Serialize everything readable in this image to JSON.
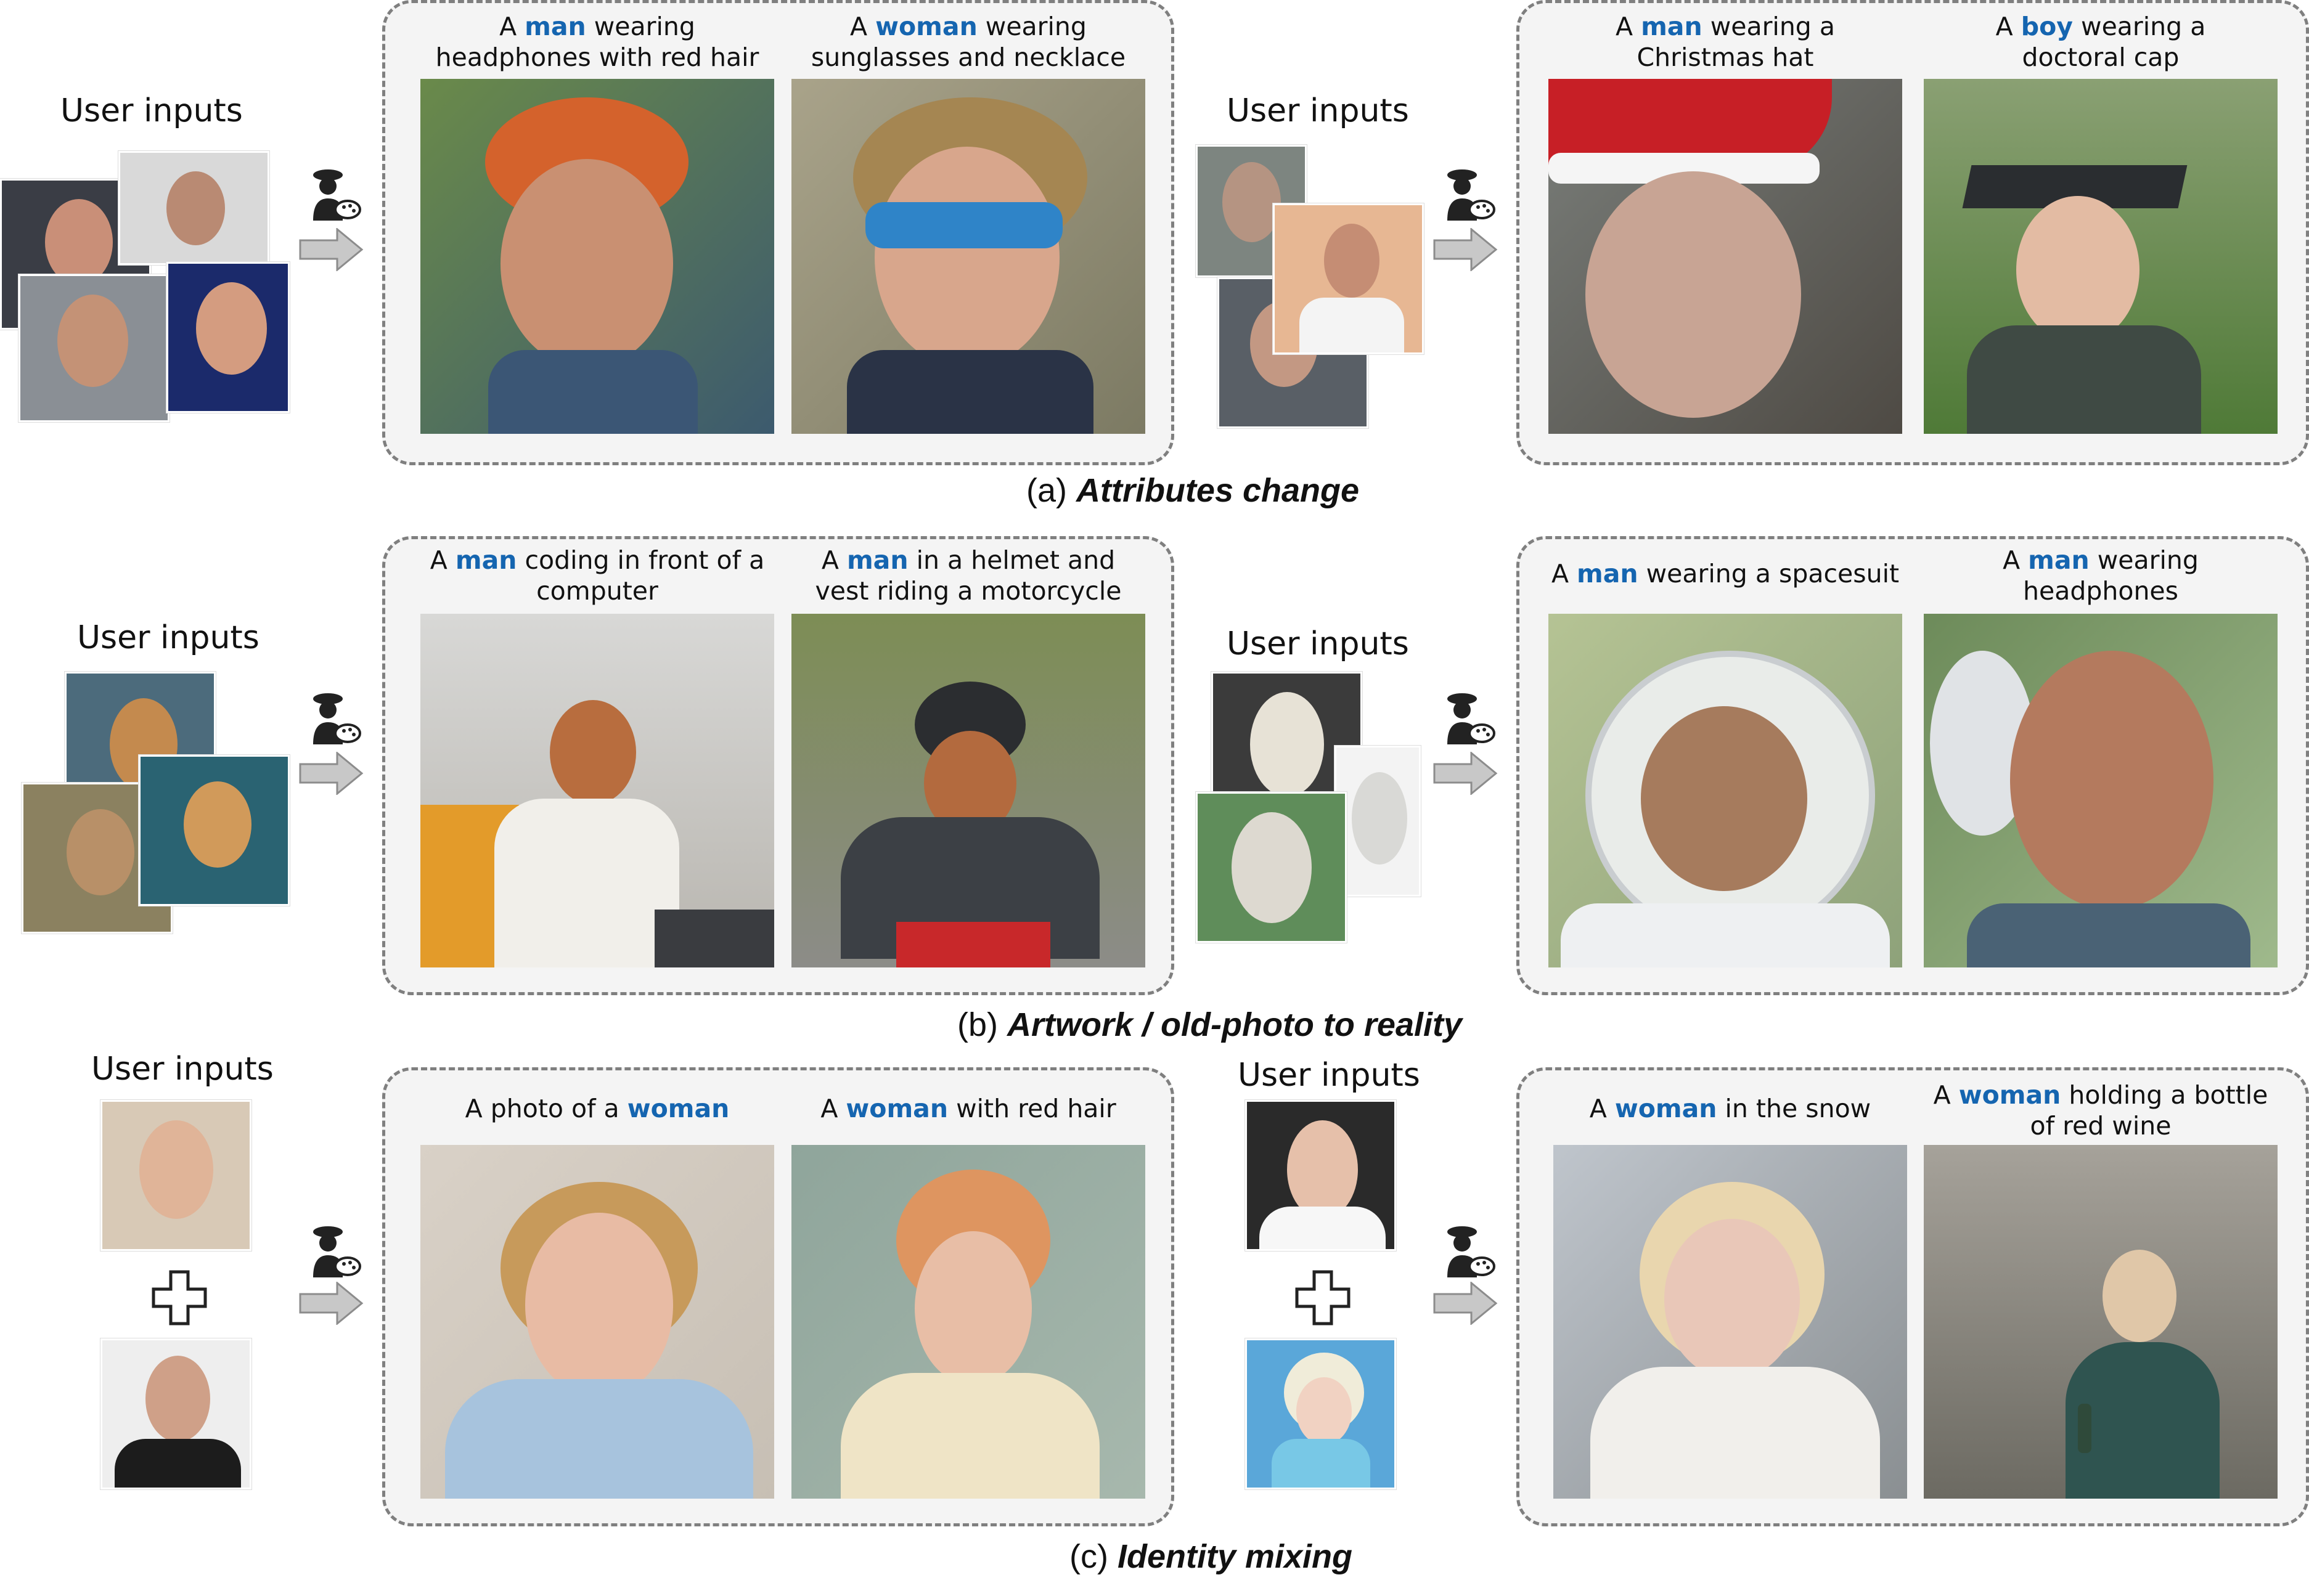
{
  "user_inputs_label": "User inputs",
  "rows": [
    {
      "section_label": {
        "prefix": "(a) ",
        "title": "Attributes change"
      },
      "groups": [
        {
          "captions": [
            {
              "parts": [
                "A ",
                "man",
                " wearing",
                "headphones with red hair"
              ]
            },
            {
              "parts": [
                "A ",
                "woman",
                " wearing",
                "sunglasses and necklace"
              ]
            }
          ]
        },
        {
          "captions": [
            {
              "parts": [
                "A ",
                "man",
                " wearing a",
                "Christmas hat"
              ]
            },
            {
              "parts": [
                "A ",
                "boy",
                " wearing a",
                "doctoral cap"
              ]
            }
          ]
        }
      ]
    },
    {
      "section_label": {
        "prefix": "(b) ",
        "title": "Artwork / old-photo to reality"
      },
      "groups": [
        {
          "captions": [
            {
              "parts": [
                "A ",
                "man",
                " coding in front of a",
                "computer"
              ]
            },
            {
              "parts": [
                "A ",
                "man",
                " in a helmet and",
                "vest riding a motorcycle"
              ]
            }
          ]
        },
        {
          "captions": [
            {
              "parts": [
                "A ",
                "man",
                " wearing a spacesuit",
                ""
              ]
            },
            {
              "parts": [
                "A ",
                "man",
                " wearing",
                "headphones"
              ]
            }
          ]
        }
      ]
    },
    {
      "section_label": {
        "prefix": "(c) ",
        "title": "Identity mixing"
      },
      "groups": [
        {
          "captions": [
            {
              "parts": [
                "A photo of a ",
                "woman",
                "",
                ""
              ]
            },
            {
              "parts": [
                "A ",
                "woman",
                " with red hair",
                ""
              ]
            }
          ]
        },
        {
          "captions": [
            {
              "parts": [
                "A ",
                "woman",
                " in the snow",
                ""
              ]
            },
            {
              "parts": [
                "A ",
                "woman",
                " holding a bottle",
                "of red wine"
              ]
            }
          ]
        }
      ]
    }
  ],
  "colors": {
    "highlight": "#1565b0",
    "panel_border": "#7f7f7f",
    "panel_fill": "#f4f4f4",
    "arrow": "#c8c8c8"
  },
  "icons": [
    "painter-palette-icon",
    "right-arrow-icon",
    "plus-icon"
  ]
}
